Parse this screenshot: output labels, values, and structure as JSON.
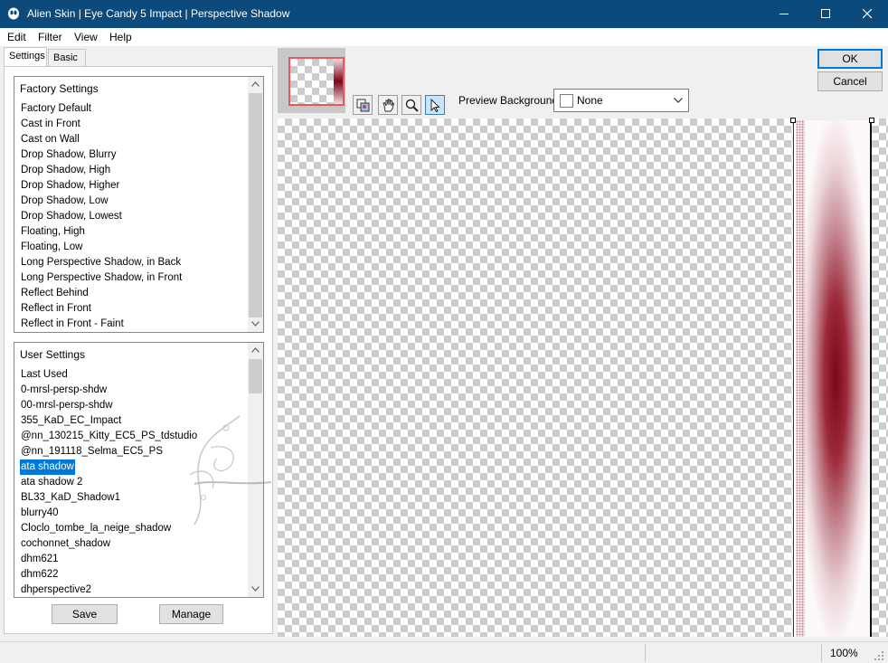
{
  "window": {
    "title": "Alien Skin | Eye Candy 5 Impact | Perspective Shadow",
    "minimize_icon": "minimize-icon",
    "maximize_icon": "maximize-icon",
    "close_icon": "close-icon"
  },
  "menu": {
    "items": [
      "Edit",
      "Filter",
      "View",
      "Help"
    ]
  },
  "tabs": [
    "Settings",
    "Basic"
  ],
  "factory_settings": {
    "header": "Factory Settings",
    "items": [
      "Factory Default",
      "Cast in Front",
      "Cast on Wall",
      "Drop Shadow, Blurry",
      "Drop Shadow, High",
      "Drop Shadow, Higher",
      "Drop Shadow, Low",
      "Drop Shadow, Lowest",
      "Floating, High",
      "Floating, Low",
      "Long Perspective Shadow, in Back",
      "Long Perspective Shadow, in Front",
      "Reflect Behind",
      "Reflect in Front",
      "Reflect in Front - Faint"
    ]
  },
  "user_settings": {
    "header": "User Settings",
    "selected": "ata shadow",
    "items": [
      "Last Used",
      "0-mrsl-persp-shdw",
      "00-mrsl-persp-shdw",
      "355_KaD_EC_Impact",
      "@nn_130215_Kitty_EC5_PS_tdstudio",
      "@nn_191118_Selma_EC5_PS",
      "ata shadow",
      "ata shadow 2",
      "BL33_KaD_Shadow1",
      "blurry40",
      "Cloclo_tombe_la_neige_shadow",
      "cochonnet_shadow",
      "dhm621",
      "dhm622",
      "dhperspective2"
    ]
  },
  "buttons": {
    "save": "Save",
    "manage": "Manage",
    "ok": "OK",
    "cancel": "Cancel"
  },
  "preview": {
    "background_label": "Preview Background:",
    "background_value": "None",
    "tools": [
      "preview-toggle-icon",
      "hand-icon",
      "zoom-icon",
      "pointer-icon"
    ],
    "shadow_color": "#7a0616"
  },
  "status": {
    "zoom": "100%"
  }
}
